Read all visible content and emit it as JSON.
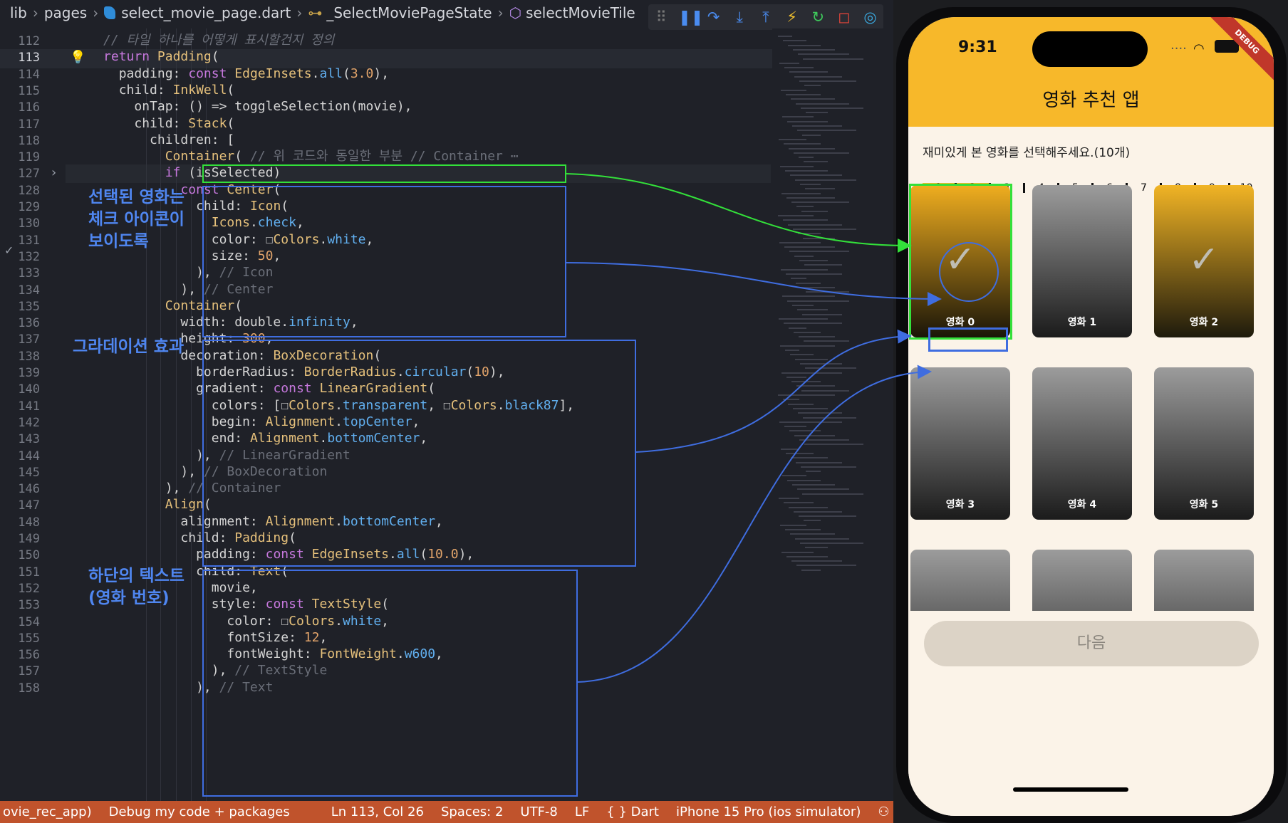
{
  "breadcrumb": {
    "items": [
      "lib",
      "pages",
      "select_movie_page.dart",
      "_SelectMoviePageState",
      "selectMovieTile"
    ]
  },
  "debug_toolbar": {
    "icons": [
      "drag-handle-icon",
      "pause-icon",
      "step-over-icon",
      "step-into-icon",
      "step-out-icon",
      "hot-reload-icon",
      "restart-icon",
      "stop-icon",
      "devtools-icon"
    ]
  },
  "code": {
    "lines": [
      {
        "n": "112",
        "text": "      // 타일 하나를 어떻게 표시할건지 정의"
      },
      {
        "n": "113",
        "text": "      return Padding("
      },
      {
        "n": "114",
        "text": "        padding: const EdgeInsets.all(3.0),"
      },
      {
        "n": "115",
        "text": "        child: InkWell("
      },
      {
        "n": "116",
        "text": "          onTap: () => toggleSelection(movie),"
      },
      {
        "n": "117",
        "text": "          child: Stack("
      },
      {
        "n": "118",
        "text": "            children: ["
      },
      {
        "n": "119",
        "text": "              Container( // 위 코드와 동일한 부분 // Container ⋯"
      },
      {
        "n": "127",
        "text": "              if (isSelected)"
      },
      {
        "n": "128",
        "text": "                const Center("
      },
      {
        "n": "129",
        "text": "                  child: Icon("
      },
      {
        "n": "130",
        "text": "                    Icons.check,"
      },
      {
        "n": "131",
        "text": "                    color: ☐Colors.white,"
      },
      {
        "n": "132",
        "text": "                    size: 50,"
      },
      {
        "n": "133",
        "text": "                  ), // Icon"
      },
      {
        "n": "134",
        "text": "                ), // Center"
      },
      {
        "n": "135",
        "text": "              Container("
      },
      {
        "n": "136",
        "text": "                width: double.infinity,"
      },
      {
        "n": "137",
        "text": "                height: 300,"
      },
      {
        "n": "138",
        "text": "                decoration: BoxDecoration("
      },
      {
        "n": "139",
        "text": "                  borderRadius: BorderRadius.circular(10),"
      },
      {
        "n": "140",
        "text": "                  gradient: const LinearGradient("
      },
      {
        "n": "141",
        "text": "                    colors: [☐Colors.transparent, ☐Colors.black87],"
      },
      {
        "n": "142",
        "text": "                    begin: Alignment.topCenter,"
      },
      {
        "n": "143",
        "text": "                    end: Alignment.bottomCenter,"
      },
      {
        "n": "144",
        "text": "                  ), // LinearGradient"
      },
      {
        "n": "145",
        "text": "                ), // BoxDecoration"
      },
      {
        "n": "146",
        "text": "              ), // Container"
      },
      {
        "n": "147",
        "text": "              Align("
      },
      {
        "n": "148",
        "text": "                alignment: Alignment.bottomCenter,"
      },
      {
        "n": "149",
        "text": "                child: Padding("
      },
      {
        "n": "150",
        "text": "                  padding: const EdgeInsets.all(10.0),"
      },
      {
        "n": "151",
        "text": "                  child: Text("
      },
      {
        "n": "152",
        "text": "                    movie,"
      },
      {
        "n": "153",
        "text": "                    style: const TextStyle("
      },
      {
        "n": "154",
        "text": "                      color: ☐Colors.white,"
      },
      {
        "n": "155",
        "text": "                      fontSize: 12,"
      },
      {
        "n": "156",
        "text": "                      fontWeight: FontWeight.w600,"
      },
      {
        "n": "157",
        "text": "                    ), // TextStyle"
      },
      {
        "n": "158",
        "text": "                  ), // Text"
      }
    ]
  },
  "annotations": {
    "check_icon": "선택된 영화는\n체크 아이콘이\n보이도록",
    "gradient": "그라데이션 효과",
    "bottom_text": "하단의 텍스트\n(영화 번호)"
  },
  "status_bar": {
    "project": "ovie_rec_app)",
    "launch": "Debug my code + packages",
    "cursor": "Ln 113, Col 26",
    "spaces": "Spaces: 2",
    "encoding": "UTF-8",
    "eol": "LF",
    "language": "{ } Dart",
    "device": "iPhone 15 Pro (ios simulator)"
  },
  "phone": {
    "time": "9:31",
    "debug_banner": "DEBUG",
    "app_title": "영화 추천 앱",
    "subtitle": "재미있게 본 영화를 선택해주세요.(10개)",
    "progress_steps": [
      "1",
      "2",
      "3",
      "4",
      "5",
      "6",
      "7",
      "8",
      "9",
      "10"
    ],
    "progress_filled": 2,
    "tiles": [
      {
        "label": "영화 0",
        "selected": true
      },
      {
        "label": "영화 1",
        "selected": false
      },
      {
        "label": "영화 2",
        "selected": true
      },
      {
        "label": "영화 3",
        "selected": false
      },
      {
        "label": "영화 4",
        "selected": false
      },
      {
        "label": "영화 5",
        "selected": false
      },
      {
        "label": "",
        "selected": false
      },
      {
        "label": "",
        "selected": false
      },
      {
        "label": "",
        "selected": false
      }
    ],
    "next_button": "다음"
  },
  "colors": {
    "accent": "#f7b82a",
    "highlight_green": "#33e03a",
    "highlight_blue": "#3f6de0",
    "status_bar": "#c0532c"
  }
}
